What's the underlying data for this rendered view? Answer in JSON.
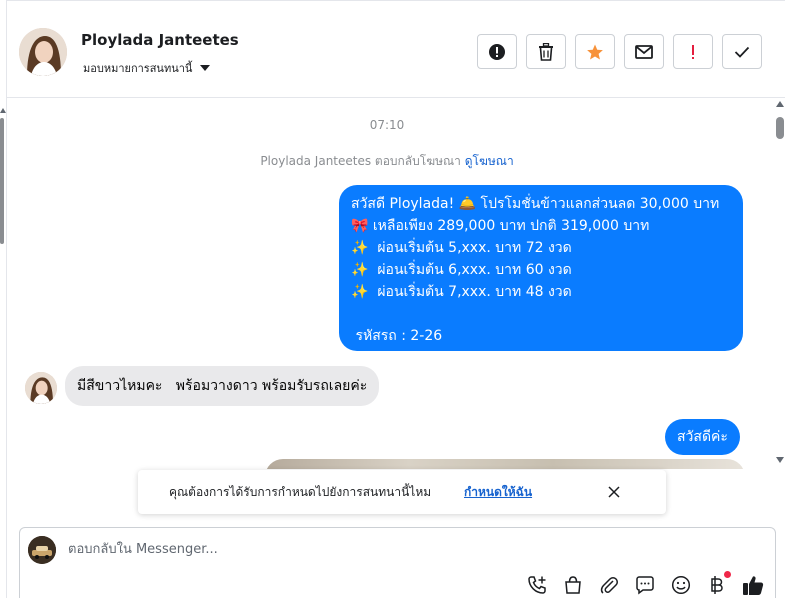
{
  "header": {
    "contact_name": "Ploylada Janteetes",
    "assign_label": "มอบหมายการสนทนานี้",
    "actions": [
      {
        "name": "report-icon",
        "label": "report"
      },
      {
        "name": "trash-icon",
        "label": "delete"
      },
      {
        "name": "star-icon",
        "label": "star"
      },
      {
        "name": "mail-icon",
        "label": "mark unread"
      },
      {
        "name": "exclamation-icon",
        "label": "spam"
      },
      {
        "name": "check-icon",
        "label": "done"
      }
    ]
  },
  "thread": {
    "timestamp": "07:10",
    "reply_note_prefix": "Ploylada Janteetes ตอบกลับโฆษณา",
    "reply_note_link": "ดูโฆษณา",
    "messages": [
      {
        "direction": "outgoing",
        "text": "สวัสดี Ploylada! 🛎️ โปรโมชั่นข้าวแลกส่วนลด 30,000 บาท\n🎀 เหลือเพียง 289,000 บาท ปกติ 319,000 บาท\n✨  ผ่อนเริ่มต้น 5,xxx. บาท 72 งวด\n✨  ผ่อนเริ่มต้น 6,xxx. บาท 60 งวด\n✨  ผ่อนเริ่มต้น 7,xxx. บาท 48 งวด\n\n รหัสรถ : 2-26"
      },
      {
        "direction": "incoming",
        "text": "มีสีขาวไหมคะ   พร้อมวางดาว พร้อมรับรถเลยค่ะ"
      },
      {
        "direction": "outgoing",
        "text": "สวัสดีค่ะ"
      }
    ]
  },
  "banner": {
    "text": "คุณต้องการได้รับการกำหนดไปยังการสนทนานี้ไหม",
    "link": "กำหนดให้ฉัน"
  },
  "composer": {
    "placeholder": "ตอบกลับใน Messenger...",
    "tools": [
      "add-call-icon",
      "shop-bag-icon",
      "attach-icon",
      "saved-reply-icon",
      "emoji-icon",
      "baht-icon",
      "thumbs-up-icon"
    ]
  },
  "colors": {
    "outgoing_bubble": "#0a7cff",
    "incoming_bubble": "#e9e9eb",
    "link": "#1763cf",
    "star": "#f7923a",
    "exclamation": "#e41e3f"
  }
}
